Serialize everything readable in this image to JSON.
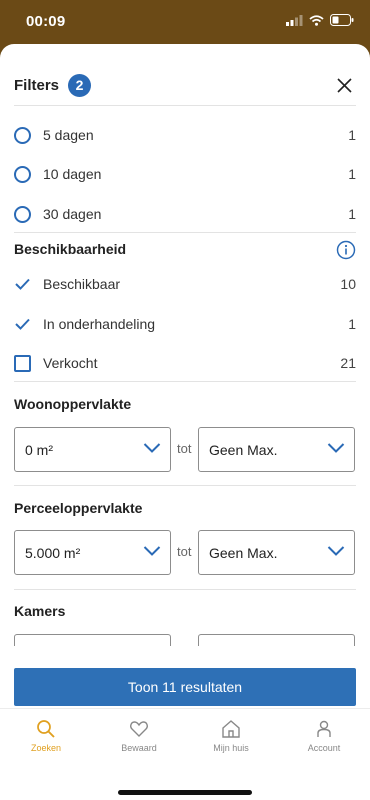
{
  "status_bar": {
    "time": "00:09"
  },
  "header": {
    "title": "Filters",
    "badge_count": "2"
  },
  "periods": [
    {
      "label": "5 dagen",
      "count": "1"
    },
    {
      "label": "10 dagen",
      "count": "1"
    },
    {
      "label": "30 dagen",
      "count": "1"
    }
  ],
  "availability": {
    "title": "Beschikbaarheid",
    "options": [
      {
        "label": "Beschikbaar",
        "count": "10",
        "checked": true
      },
      {
        "label": "In onderhandeling",
        "count": "1",
        "checked": true
      },
      {
        "label": "Verkocht",
        "count": "21",
        "checked": false
      }
    ]
  },
  "living_area": {
    "title": "Woonoppervlakte",
    "min": "0 m²",
    "separator": "tot",
    "max": "Geen Max."
  },
  "plot_area": {
    "title": "Perceeloppervlakte",
    "min": "5.000 m²",
    "separator": "tot",
    "max": "Geen Max."
  },
  "rooms": {
    "title": "Kamers"
  },
  "cta": {
    "label": "Toon 11 resultaten"
  },
  "tabs": [
    {
      "label": "Zoeken",
      "icon": "search-icon",
      "active": true
    },
    {
      "label": "Bewaard",
      "icon": "heart-icon",
      "active": false
    },
    {
      "label": "Mijn huis",
      "icon": "home-icon",
      "active": false
    },
    {
      "label": "Account",
      "icon": "user-icon",
      "active": false
    }
  ],
  "colors": {
    "accent_blue": "#2a6ab6",
    "active_tab": "#e0a020",
    "status_bar_bg": "#6b4a16"
  }
}
